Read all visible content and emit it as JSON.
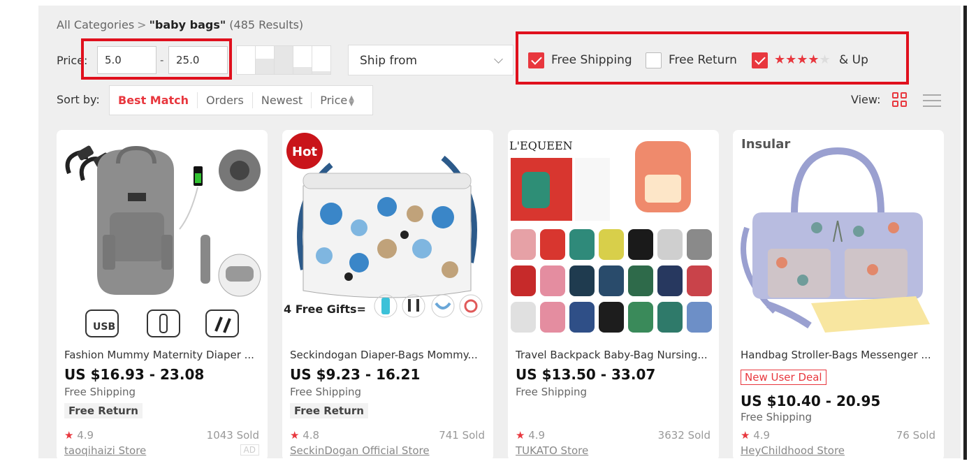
{
  "breadcrumb": {
    "root": "All Categories",
    "separator": ">",
    "keyword": "\"baby bags\"",
    "count": "(485 Results)"
  },
  "filters": {
    "price_label": "Price:",
    "price_min": "5.0",
    "price_max": "25.0",
    "price_dash": "-",
    "ship_from": "Ship from",
    "free_shipping": {
      "label": "Free Shipping",
      "checked": true
    },
    "free_return": {
      "label": "Free Return",
      "checked": false
    },
    "rating": {
      "label": "& Up",
      "checked": true,
      "stars": 4
    }
  },
  "sort": {
    "label": "Sort by:",
    "options": [
      "Best Match",
      "Orders",
      "Newest",
      "Price"
    ],
    "active": "Best Match"
  },
  "view": {
    "label": "View:",
    "active": "grid"
  },
  "accent": "#e8373e",
  "products": [
    {
      "title": "Fashion Mummy Maternity Diaper ...",
      "price": "US $16.93 - 23.08",
      "shipping": "Free Shipping",
      "free_return": "Free Return",
      "rating": "4.9",
      "sold": "1043 Sold",
      "store": "taoqihaizi Store",
      "ad": "AD"
    },
    {
      "title": "Seckindogan Diaper-Bags Mommy...",
      "price": "US $9.23 - 16.21",
      "shipping": "Free Shipping",
      "free_return": "Free Return",
      "rating": "4.8",
      "sold": "741 Sold",
      "store": "SeckinDogan Official Store",
      "badge": "Hot",
      "image_text": "4 Free Gifts="
    },
    {
      "title": "Travel Backpack Baby-Bag Nursing...",
      "price": "US $13.50 - 33.07",
      "shipping": "Free Shipping",
      "rating": "4.9",
      "sold": "3632 Sold",
      "store": "TUKATO Store",
      "brand": "L'EQUEEN"
    },
    {
      "title": "Handbag Stroller-Bags Messenger ...",
      "deal": "New User Deal",
      "price": "US $10.40 - 20.95",
      "shipping": "Free Shipping",
      "rating": "4.9",
      "sold": "76 Sold",
      "store": "HeyChildhood Store",
      "brand": "Insular"
    }
  ]
}
